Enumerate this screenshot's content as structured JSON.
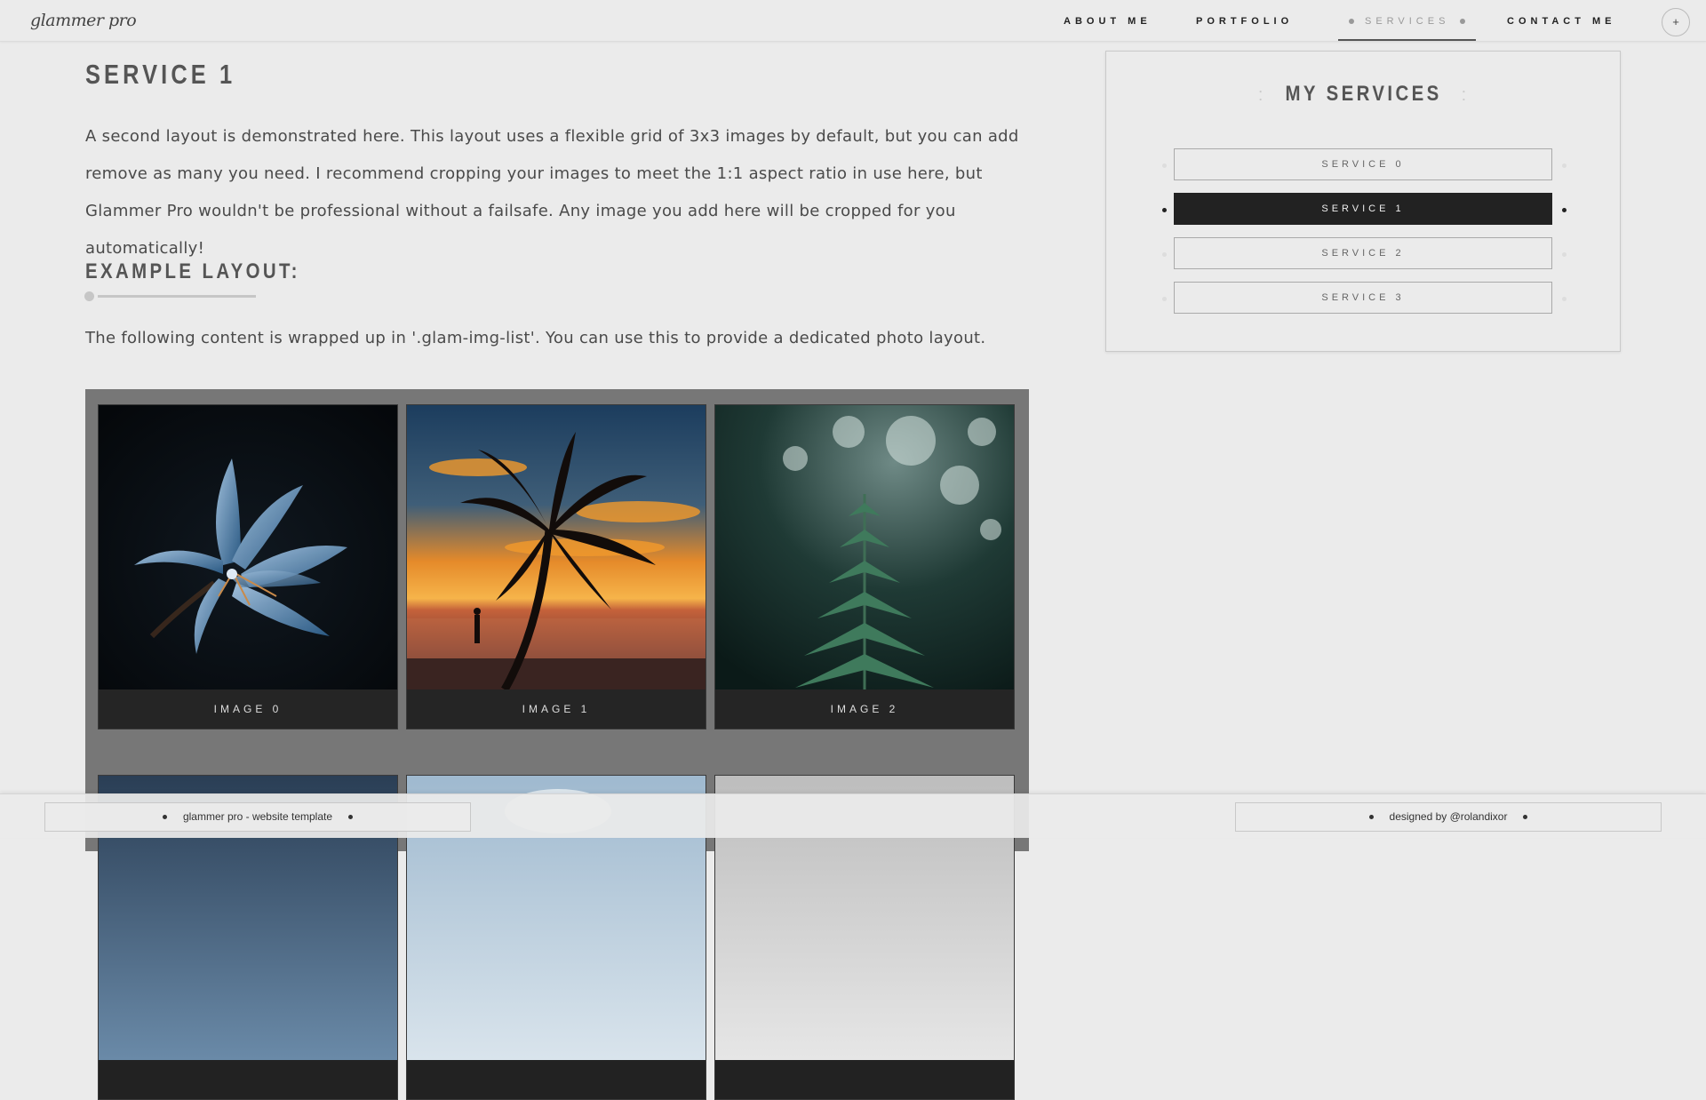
{
  "header": {
    "logo": "glammer pro",
    "nav": [
      {
        "label": "ABOUT ME"
      },
      {
        "label": "PORTFOLIO"
      },
      {
        "label": "SERVICES"
      },
      {
        "label": "CONTACT ME"
      }
    ],
    "active_nav": "SERVICES",
    "plus_label": "+"
  },
  "main": {
    "title": "SERVICE 1",
    "intro": "A second layout is demonstrated here. This layout uses a flexible grid of 3x3 images by default, but you can add remove as many you need. I recommend cropping your images to meet the 1:1 aspect ratio in use here, but Glammer Pro wouldn't be professional without a failsafe. Any image you add here will be cropped for you automatically!",
    "section_heading": "EXAMPLE LAYOUT:",
    "section_text": "The following content is wrapped up in '.glam-img-list'. You can use this to provide a dedicated photo layout.",
    "gallery": [
      {
        "caption": "IMAGE 0"
      },
      {
        "caption": "IMAGE 1"
      },
      {
        "caption": "IMAGE 2"
      },
      {
        "caption": ""
      },
      {
        "caption": ""
      },
      {
        "caption": ""
      }
    ]
  },
  "sidebar": {
    "title": "MY SERVICES",
    "services": [
      {
        "label": "SERVICE 0"
      },
      {
        "label": "SERVICE 1"
      },
      {
        "label": "SERVICE 2"
      },
      {
        "label": "SERVICE 3"
      }
    ],
    "active_service": "SERVICE 1"
  },
  "footer": {
    "left": "glammer pro - website template",
    "right": "designed by @rolandixor"
  },
  "colors": {
    "background": "#ebebeb",
    "dark": "#222222",
    "gallery_bg": "#777777"
  }
}
